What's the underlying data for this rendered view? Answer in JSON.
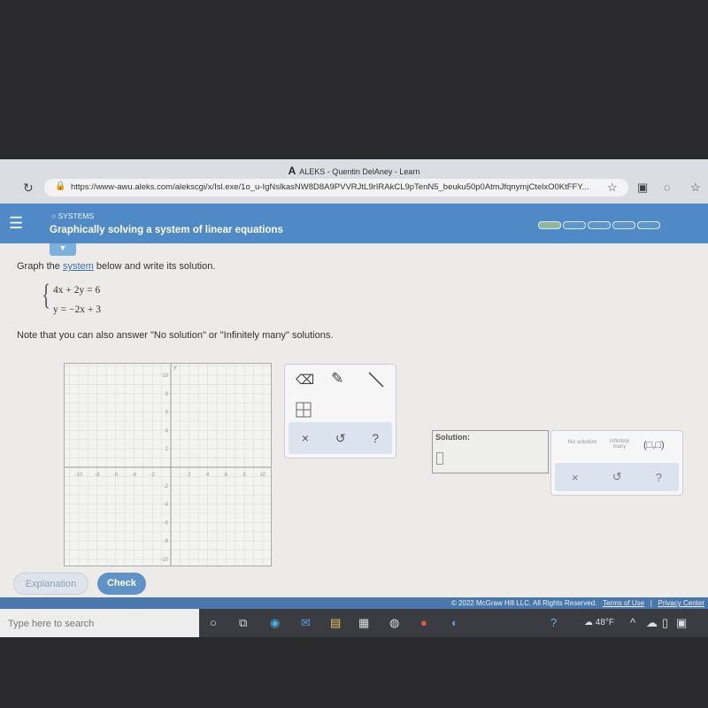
{
  "browser": {
    "tab_title": "ALEKS - Quentin DelAney - Learn",
    "url": "https://www-awu.aleks.com/alekscgi/x/Isl.exe/1o_u-IgNslkasNW8D8A9PVVRJtL9rIRAkCL9pTenN5_beuku50p0AtmJfqnymjCtelxO0KtFFY..."
  },
  "header": {
    "section": "SYSTEMS",
    "title": "Graphically solving a system of linear equations",
    "progress_segments": 5,
    "progress_completed": 1,
    "accent": "#4f8ac6"
  },
  "problem": {
    "prompt_before": "Graph the ",
    "prompt_link": "system",
    "prompt_after": " below and write its solution.",
    "eq1": "4x + 2y = 6",
    "eq2": "y = −2x + 3",
    "note": "Note that you can also answer \"No solution\" or \"Infinitely many\" solutions."
  },
  "graph": {
    "xlabel": "x",
    "ylabel": "y",
    "xrange": [
      -10,
      10
    ],
    "yrange": [
      -10,
      10
    ],
    "x_ticks": [
      "-10",
      "-8",
      "-6",
      "-4",
      "-2",
      "2",
      "4",
      "6",
      "8",
      "10"
    ],
    "y_ticks": [
      "10",
      "8",
      "6",
      "4",
      "2",
      "-2",
      "-4",
      "-6",
      "-8",
      "-10"
    ]
  },
  "tools": {
    "icons": [
      "eraser-icon",
      "pencil-icon",
      "line-icon",
      "grid-point-icon"
    ],
    "clear": "×",
    "undo": "↺",
    "help": "?"
  },
  "solution": {
    "label": "Solution:",
    "no_solution": "No solution",
    "infinitely_many": "Infinitely many",
    "ordered_pair": "(□,□)",
    "clear": "×",
    "undo": "↺",
    "help": "?"
  },
  "actions": {
    "explanation": "Explanation",
    "check": "Check"
  },
  "footer": {
    "copyright": "© 2022 McGraw Hill LLC. All Rights Reserved.",
    "terms": "Terms of Use",
    "sep": "|",
    "privacy": "Privacy Center"
  },
  "taskbar": {
    "search_placeholder": "Type here to search",
    "weather": "48°F"
  }
}
